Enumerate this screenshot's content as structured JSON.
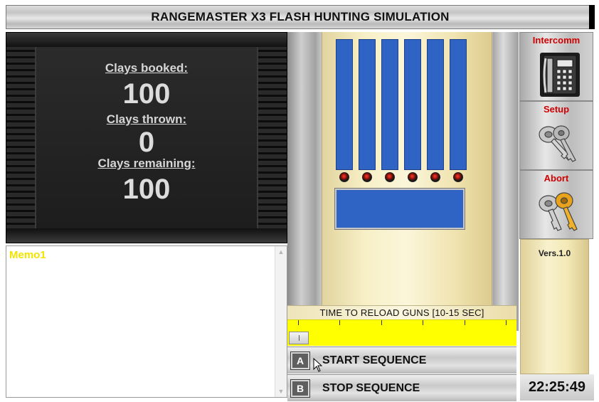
{
  "header": {
    "title": "RANGEMASTER X3 FLASH HUNTING SIMULATION"
  },
  "counter": {
    "booked_label": "Clays booked:",
    "booked_value": "100",
    "thrown_label": "Clays thrown:",
    "thrown_value": "0",
    "remaining_label": "Clays remaining:",
    "remaining_value": "100"
  },
  "memo": {
    "text": "Memo1"
  },
  "guns": {
    "tube_count": 6,
    "tube_color": "#2f63c4",
    "led_color": "#d01a10"
  },
  "reload": {
    "label": "TIME TO RELOAD GUNS [10-15 SEC]",
    "bar_color": "#ffff00",
    "level": 0
  },
  "sequence": {
    "start_key": "A",
    "start_label": "START SEQUENCE",
    "stop_key": "B",
    "stop_label": "STOP SEQUENCE"
  },
  "side": {
    "intercomm_label": "Intercomm",
    "intercomm_icon": "telephone-icon",
    "setup_label": "Setup",
    "setup_icon": "keys-icon",
    "abort_label": "Abort",
    "abort_icon": "keys-gold-icon",
    "version": "Vers.1.0",
    "clock": "22:25:49",
    "label_color": "#d10000"
  }
}
